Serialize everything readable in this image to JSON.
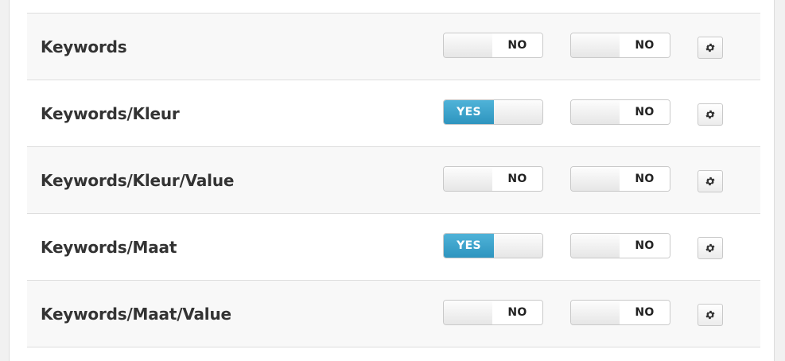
{
  "rows": [
    {
      "label": "Keywords",
      "toggle1": {
        "state": "off",
        "text": "NO"
      },
      "toggle2": {
        "state": "off",
        "text": "NO"
      },
      "settings_icon": "gear-icon"
    },
    {
      "label": "Keywords/Kleur",
      "toggle1": {
        "state": "on",
        "text": "YES"
      },
      "toggle2": {
        "state": "off",
        "text": "NO"
      },
      "settings_icon": "gear-icon"
    },
    {
      "label": "Keywords/Kleur/Value",
      "toggle1": {
        "state": "off",
        "text": "NO"
      },
      "toggle2": {
        "state": "off",
        "text": "NO"
      },
      "settings_icon": "gear-icon"
    },
    {
      "label": "Keywords/Maat",
      "toggle1": {
        "state": "on",
        "text": "YES"
      },
      "toggle2": {
        "state": "off",
        "text": "NO"
      },
      "settings_icon": "gear-icon"
    },
    {
      "label": "Keywords/Maat/Value",
      "toggle1": {
        "state": "off",
        "text": "NO"
      },
      "toggle2": {
        "state": "off",
        "text": "NO"
      },
      "settings_icon": "gear-icon"
    }
  ],
  "colors": {
    "on_fill": "#3aa3cc",
    "row_alt": "#f8f8f8",
    "text": "#333333"
  }
}
